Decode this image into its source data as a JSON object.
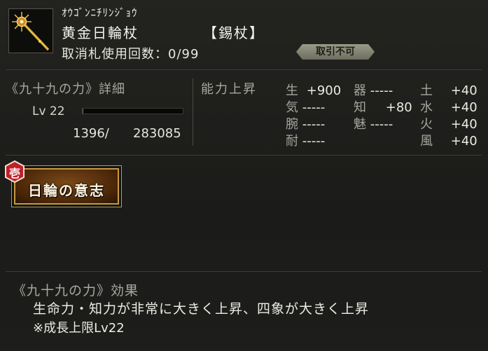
{
  "item": {
    "kana": "ｵｳｺﾞﾝﾆﾁﾘﾝｼﾞｮｳ",
    "name": "黄金日輪杖",
    "type": "【錫杖】",
    "use_count": "取消札使用回数：0/99",
    "trade_badge": "取引不可"
  },
  "power": {
    "title": "《九十九の力》詳細",
    "level": "Lv 22",
    "exp_current": "1396/",
    "exp_total": "283085",
    "exp_fraction": 0.005
  },
  "abilities": {
    "title": "能力上昇",
    "col1": [
      {
        "k": "生",
        "v": "+900"
      },
      {
        "k": "気",
        "v": "-----"
      },
      {
        "k": "腕",
        "v": "-----"
      },
      {
        "k": "耐",
        "v": "-----"
      }
    ],
    "col2": [
      {
        "k": "器",
        "v": "-----"
      },
      {
        "k": "知",
        "v": "+80"
      },
      {
        "k": "魅",
        "v": "-----"
      }
    ],
    "col3": [
      {
        "k": "土",
        "v": "+40"
      },
      {
        "k": "水",
        "v": "+40"
      },
      {
        "k": "火",
        "v": "+40"
      },
      {
        "k": "風",
        "v": "+40"
      }
    ]
  },
  "skill": {
    "badge": "壱",
    "label": "日輪の意志"
  },
  "effect": {
    "title": "《九十九の力》効果",
    "description": "生命力・知力が非常に大きく上昇、四象が大きく上昇",
    "note": "※成長上限Lv22"
  },
  "colors": {
    "badge_red": "#c0202a",
    "skill_border": "#c89a40",
    "skill_bg": "#5a300c"
  }
}
